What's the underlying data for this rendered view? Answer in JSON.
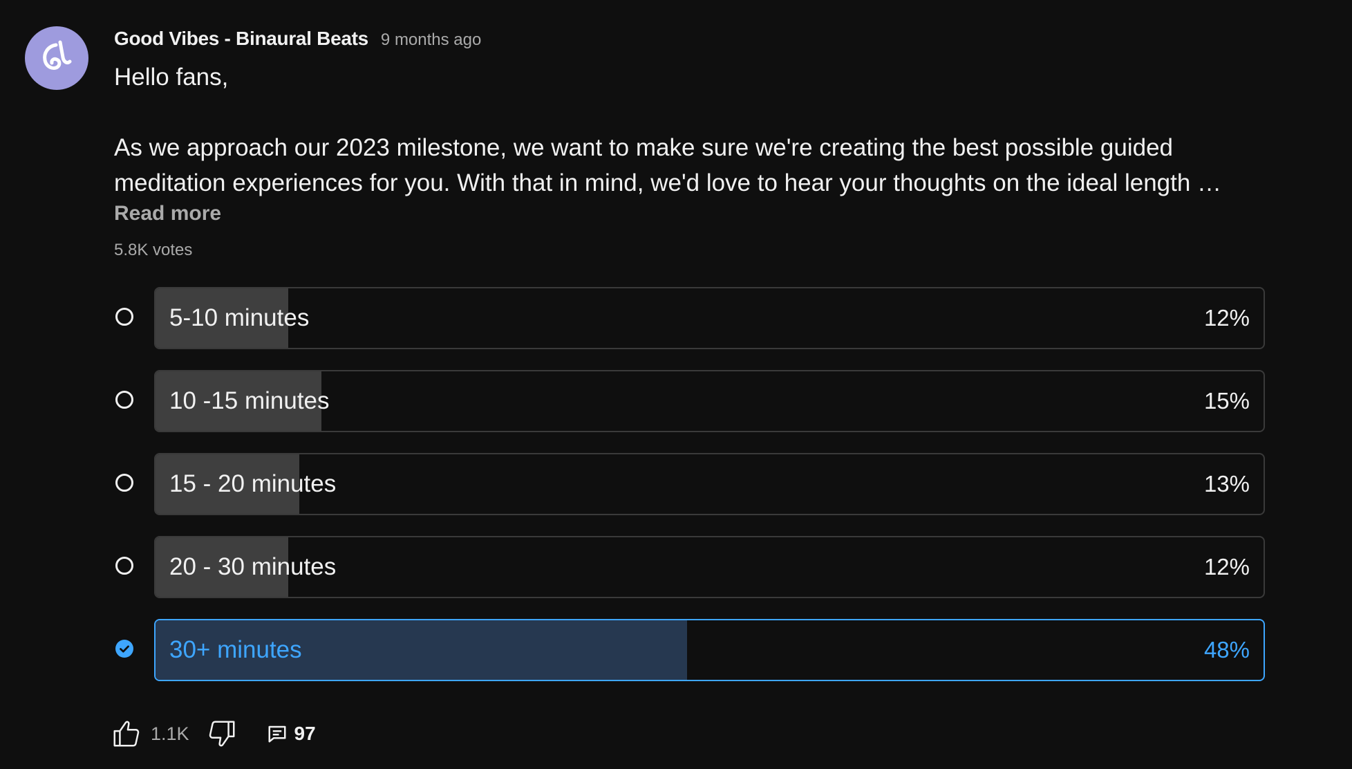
{
  "post": {
    "author": "Good Vibes - Binaural Beats",
    "timestamp": "9 months ago",
    "body_lines": [
      "Hello fans,",
      "As we approach our 2023 milestone, we want to make sure we're creating the best possible guided",
      "meditation experiences for you. With that in mind, we'd love to hear your thoughts on the ideal length …"
    ],
    "read_more": "Read more",
    "votes": "5.8K votes"
  },
  "poll": {
    "options": [
      {
        "label": "5-10 minutes",
        "percent_text": "12%",
        "fill": 0.12,
        "selected": false
      },
      {
        "label": "10 -15 minutes",
        "percent_text": "15%",
        "fill": 0.15,
        "selected": false
      },
      {
        "label": "15 - 20 minutes",
        "percent_text": "13%",
        "fill": 0.13,
        "selected": false
      },
      {
        "label": "20 - 30 minutes",
        "percent_text": "12%",
        "fill": 0.12,
        "selected": false
      },
      {
        "label": "30+ minutes",
        "percent_text": "48%",
        "fill": 0.48,
        "selected": true
      }
    ]
  },
  "actions": {
    "like_count": "1.1K",
    "comment_count": "97"
  },
  "colors": {
    "background": "#0f0f0f",
    "accent": "#3ea6ff",
    "bar_fill": "#3f3f3f",
    "selected_fill": "#263850"
  },
  "icons": [
    "channel-avatar-logo",
    "like-icon",
    "dislike-icon",
    "comment-icon",
    "check-circle-icon"
  ]
}
